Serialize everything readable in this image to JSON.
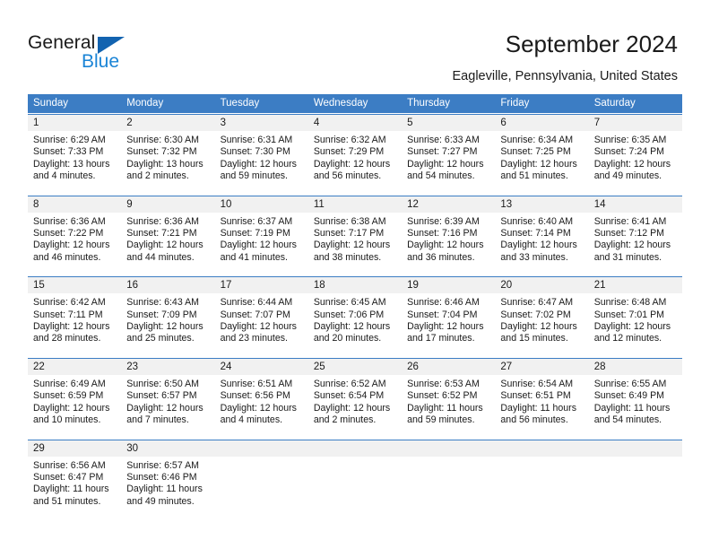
{
  "brand": {
    "name_top": "General",
    "name_bottom": "Blue",
    "triangle_color": "#1263b0",
    "blue_text_color": "#1a84d6"
  },
  "header": {
    "title": "September 2024",
    "subtitle": "Eagleville, Pennsylvania, United States"
  },
  "colors": {
    "header_blue": "#3c7dc4",
    "day_number_band": "#f1f1f1",
    "text": "#1a1a1a"
  },
  "weekdays": [
    "Sunday",
    "Monday",
    "Tuesday",
    "Wednesday",
    "Thursday",
    "Friday",
    "Saturday"
  ],
  "weeks": [
    [
      {
        "day": "1",
        "sunrise": "Sunrise: 6:29 AM",
        "sunset": "Sunset: 7:33 PM",
        "daylight1": "Daylight: 13 hours",
        "daylight2": "and 4 minutes."
      },
      {
        "day": "2",
        "sunrise": "Sunrise: 6:30 AM",
        "sunset": "Sunset: 7:32 PM",
        "daylight1": "Daylight: 13 hours",
        "daylight2": "and 2 minutes."
      },
      {
        "day": "3",
        "sunrise": "Sunrise: 6:31 AM",
        "sunset": "Sunset: 7:30 PM",
        "daylight1": "Daylight: 12 hours",
        "daylight2": "and 59 minutes."
      },
      {
        "day": "4",
        "sunrise": "Sunrise: 6:32 AM",
        "sunset": "Sunset: 7:29 PM",
        "daylight1": "Daylight: 12 hours",
        "daylight2": "and 56 minutes."
      },
      {
        "day": "5",
        "sunrise": "Sunrise: 6:33 AM",
        "sunset": "Sunset: 7:27 PM",
        "daylight1": "Daylight: 12 hours",
        "daylight2": "and 54 minutes."
      },
      {
        "day": "6",
        "sunrise": "Sunrise: 6:34 AM",
        "sunset": "Sunset: 7:25 PM",
        "daylight1": "Daylight: 12 hours",
        "daylight2": "and 51 minutes."
      },
      {
        "day": "7",
        "sunrise": "Sunrise: 6:35 AM",
        "sunset": "Sunset: 7:24 PM",
        "daylight1": "Daylight: 12 hours",
        "daylight2": "and 49 minutes."
      }
    ],
    [
      {
        "day": "8",
        "sunrise": "Sunrise: 6:36 AM",
        "sunset": "Sunset: 7:22 PM",
        "daylight1": "Daylight: 12 hours",
        "daylight2": "and 46 minutes."
      },
      {
        "day": "9",
        "sunrise": "Sunrise: 6:36 AM",
        "sunset": "Sunset: 7:21 PM",
        "daylight1": "Daylight: 12 hours",
        "daylight2": "and 44 minutes."
      },
      {
        "day": "10",
        "sunrise": "Sunrise: 6:37 AM",
        "sunset": "Sunset: 7:19 PM",
        "daylight1": "Daylight: 12 hours",
        "daylight2": "and 41 minutes."
      },
      {
        "day": "11",
        "sunrise": "Sunrise: 6:38 AM",
        "sunset": "Sunset: 7:17 PM",
        "daylight1": "Daylight: 12 hours",
        "daylight2": "and 38 minutes."
      },
      {
        "day": "12",
        "sunrise": "Sunrise: 6:39 AM",
        "sunset": "Sunset: 7:16 PM",
        "daylight1": "Daylight: 12 hours",
        "daylight2": "and 36 minutes."
      },
      {
        "day": "13",
        "sunrise": "Sunrise: 6:40 AM",
        "sunset": "Sunset: 7:14 PM",
        "daylight1": "Daylight: 12 hours",
        "daylight2": "and 33 minutes."
      },
      {
        "day": "14",
        "sunrise": "Sunrise: 6:41 AM",
        "sunset": "Sunset: 7:12 PM",
        "daylight1": "Daylight: 12 hours",
        "daylight2": "and 31 minutes."
      }
    ],
    [
      {
        "day": "15",
        "sunrise": "Sunrise: 6:42 AM",
        "sunset": "Sunset: 7:11 PM",
        "daylight1": "Daylight: 12 hours",
        "daylight2": "and 28 minutes."
      },
      {
        "day": "16",
        "sunrise": "Sunrise: 6:43 AM",
        "sunset": "Sunset: 7:09 PM",
        "daylight1": "Daylight: 12 hours",
        "daylight2": "and 25 minutes."
      },
      {
        "day": "17",
        "sunrise": "Sunrise: 6:44 AM",
        "sunset": "Sunset: 7:07 PM",
        "daylight1": "Daylight: 12 hours",
        "daylight2": "and 23 minutes."
      },
      {
        "day": "18",
        "sunrise": "Sunrise: 6:45 AM",
        "sunset": "Sunset: 7:06 PM",
        "daylight1": "Daylight: 12 hours",
        "daylight2": "and 20 minutes."
      },
      {
        "day": "19",
        "sunrise": "Sunrise: 6:46 AM",
        "sunset": "Sunset: 7:04 PM",
        "daylight1": "Daylight: 12 hours",
        "daylight2": "and 17 minutes."
      },
      {
        "day": "20",
        "sunrise": "Sunrise: 6:47 AM",
        "sunset": "Sunset: 7:02 PM",
        "daylight1": "Daylight: 12 hours",
        "daylight2": "and 15 minutes."
      },
      {
        "day": "21",
        "sunrise": "Sunrise: 6:48 AM",
        "sunset": "Sunset: 7:01 PM",
        "daylight1": "Daylight: 12 hours",
        "daylight2": "and 12 minutes."
      }
    ],
    [
      {
        "day": "22",
        "sunrise": "Sunrise: 6:49 AM",
        "sunset": "Sunset: 6:59 PM",
        "daylight1": "Daylight: 12 hours",
        "daylight2": "and 10 minutes."
      },
      {
        "day": "23",
        "sunrise": "Sunrise: 6:50 AM",
        "sunset": "Sunset: 6:57 PM",
        "daylight1": "Daylight: 12 hours",
        "daylight2": "and 7 minutes."
      },
      {
        "day": "24",
        "sunrise": "Sunrise: 6:51 AM",
        "sunset": "Sunset: 6:56 PM",
        "daylight1": "Daylight: 12 hours",
        "daylight2": "and 4 minutes."
      },
      {
        "day": "25",
        "sunrise": "Sunrise: 6:52 AM",
        "sunset": "Sunset: 6:54 PM",
        "daylight1": "Daylight: 12 hours",
        "daylight2": "and 2 minutes."
      },
      {
        "day": "26",
        "sunrise": "Sunrise: 6:53 AM",
        "sunset": "Sunset: 6:52 PM",
        "daylight1": "Daylight: 11 hours",
        "daylight2": "and 59 minutes."
      },
      {
        "day": "27",
        "sunrise": "Sunrise: 6:54 AM",
        "sunset": "Sunset: 6:51 PM",
        "daylight1": "Daylight: 11 hours",
        "daylight2": "and 56 minutes."
      },
      {
        "day": "28",
        "sunrise": "Sunrise: 6:55 AM",
        "sunset": "Sunset: 6:49 PM",
        "daylight1": "Daylight: 11 hours",
        "daylight2": "and 54 minutes."
      }
    ],
    [
      {
        "day": "29",
        "sunrise": "Sunrise: 6:56 AM",
        "sunset": "Sunset: 6:47 PM",
        "daylight1": "Daylight: 11 hours",
        "daylight2": "and 51 minutes."
      },
      {
        "day": "30",
        "sunrise": "Sunrise: 6:57 AM",
        "sunset": "Sunset: 6:46 PM",
        "daylight1": "Daylight: 11 hours",
        "daylight2": "and 49 minutes."
      },
      {
        "day": "",
        "sunrise": "",
        "sunset": "",
        "daylight1": "",
        "daylight2": ""
      },
      {
        "day": "",
        "sunrise": "",
        "sunset": "",
        "daylight1": "",
        "daylight2": ""
      },
      {
        "day": "",
        "sunrise": "",
        "sunset": "",
        "daylight1": "",
        "daylight2": ""
      },
      {
        "day": "",
        "sunrise": "",
        "sunset": "",
        "daylight1": "",
        "daylight2": ""
      },
      {
        "day": "",
        "sunrise": "",
        "sunset": "",
        "daylight1": "",
        "daylight2": ""
      }
    ]
  ]
}
